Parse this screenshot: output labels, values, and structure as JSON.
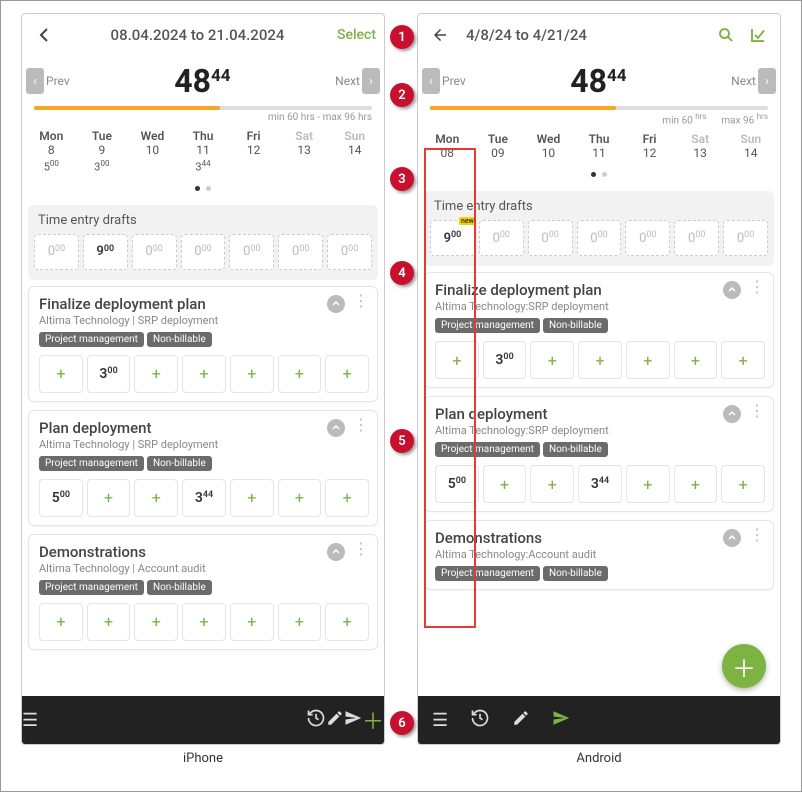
{
  "iphone": {
    "topbar": {
      "title": "08.04.2024 to 21.04.2024",
      "select": "Select"
    },
    "nav": {
      "prev": "Prev",
      "next": "Next"
    },
    "total": {
      "hours": "48",
      "mins": "44"
    },
    "progress": {
      "label": "min 60 hrs - max 96 hrs",
      "pct": 55
    },
    "week": [
      {
        "name": "Mon",
        "num": "8",
        "time_h": "5",
        "time_m": "00"
      },
      {
        "name": "Tue",
        "num": "9",
        "time_h": "3",
        "time_m": "00"
      },
      {
        "name": "Wed",
        "num": "10",
        "time_h": "",
        "time_m": ""
      },
      {
        "name": "Thu",
        "num": "11",
        "time_h": "3",
        "time_m": "44"
      },
      {
        "name": "Fri",
        "num": "12",
        "time_h": "",
        "time_m": ""
      },
      {
        "name": "Sat",
        "num": "13",
        "time_h": "",
        "time_m": "",
        "weekend": true
      },
      {
        "name": "Sun",
        "num": "14",
        "time_h": "",
        "time_m": "",
        "weekend": true
      }
    ],
    "drafts_title": "Time entry drafts",
    "drafts": [
      {
        "h": "0",
        "m": "00",
        "has": false
      },
      {
        "h": "9",
        "m": "00",
        "has": true
      },
      {
        "h": "0",
        "m": "00",
        "has": false
      },
      {
        "h": "0",
        "m": "00",
        "has": false
      },
      {
        "h": "0",
        "m": "00",
        "has": false
      },
      {
        "h": "0",
        "m": "00",
        "has": false
      },
      {
        "h": "0",
        "m": "00",
        "has": false
      }
    ],
    "tasks": [
      {
        "title": "Finalize deployment plan",
        "sub": "Altima Technology | SRP deployment",
        "tags": [
          "Project management",
          "Non-billable"
        ],
        "cells": [
          "+",
          "3:00",
          "+",
          "+",
          "+",
          "+",
          "+"
        ]
      },
      {
        "title": "Plan deployment",
        "sub": "Altima Technology | SRP deployment",
        "tags": [
          "Project management",
          "Non-billable"
        ],
        "cells": [
          "5:00",
          "+",
          "+",
          "3:44",
          "+",
          "+",
          "+"
        ]
      },
      {
        "title": "Demonstrations",
        "sub": "Altima Technology | Account audit",
        "tags": [
          "Project management",
          "Non-billable"
        ],
        "cells": [
          "+",
          "+",
          "+",
          "+",
          "+",
          "+",
          "+"
        ]
      }
    ]
  },
  "android": {
    "topbar": {
      "title": "4/8/24 to 4/21/24"
    },
    "nav": {
      "prev": "Prev",
      "next": "Next"
    },
    "total": {
      "hours": "48",
      "mins": "44"
    },
    "progress": {
      "min_label": "min 60",
      "min_unit": "hrs",
      "max_label": "max 96",
      "max_unit": "hrs",
      "pct": 55
    },
    "week": [
      {
        "name": "Mon",
        "num": "08"
      },
      {
        "name": "Tue",
        "num": "09"
      },
      {
        "name": "Wed",
        "num": "10"
      },
      {
        "name": "Thu",
        "num": "11"
      },
      {
        "name": "Fri",
        "num": "12"
      },
      {
        "name": "Sat",
        "num": "13",
        "weekend": true
      },
      {
        "name": "Sun",
        "num": "14",
        "weekend": true
      }
    ],
    "drafts_title": "Time entry drafts",
    "drafts": [
      {
        "h": "9",
        "m": "00",
        "has": true,
        "new": true
      },
      {
        "h": "0",
        "m": "00",
        "has": false
      },
      {
        "h": "0",
        "m": "00",
        "has": false
      },
      {
        "h": "0",
        "m": "00",
        "has": false
      },
      {
        "h": "0",
        "m": "00",
        "has": false
      },
      {
        "h": "0",
        "m": "00",
        "has": false
      },
      {
        "h": "0",
        "m": "00",
        "has": false
      }
    ],
    "tasks": [
      {
        "title": "Finalize deployment plan",
        "sub": "Altima Technology:SRP deployment",
        "tags": [
          "Project management",
          "Non-billable"
        ],
        "cells": [
          "+",
          "3:00",
          "+",
          "+",
          "+",
          "+",
          "+"
        ]
      },
      {
        "title": "Plan deployment",
        "sub": "Altima Technology:SRP deployment",
        "tags": [
          "Project management",
          "Non-billable"
        ],
        "cells": [
          "5:00",
          "+",
          "+",
          "3:44",
          "+",
          "+",
          "+"
        ]
      },
      {
        "title": "Demonstrations",
        "sub": "Altima Technology:Account audit",
        "tags": [
          "Project management",
          "Non-billable"
        ],
        "cells": []
      }
    ]
  },
  "annotations": [
    "1",
    "2",
    "3",
    "4",
    "5",
    "6"
  ],
  "labels": {
    "iphone": "iPhone",
    "android": "Android"
  }
}
